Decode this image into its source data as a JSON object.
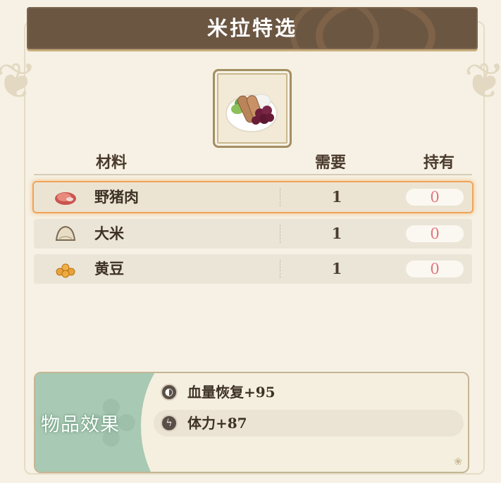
{
  "title": "米拉特选",
  "table": {
    "headers": {
      "material": "材料",
      "need": "需要",
      "own": "持有"
    },
    "rows": [
      {
        "name": "野猪肉",
        "need": "1",
        "own": "0",
        "icon": "boar-meat-icon",
        "selected": true
      },
      {
        "name": "大米",
        "need": "1",
        "own": "0",
        "icon": "rice-sack-icon",
        "selected": false
      },
      {
        "name": "黄豆",
        "need": "1",
        "own": "0",
        "icon": "soybean-icon",
        "selected": false
      }
    ]
  },
  "effects": {
    "label": "物品效果",
    "items": [
      {
        "text": "血量恢复+95",
        "icon": "health-restore-icon"
      },
      {
        "text": "体力+87",
        "icon": "stamina-bolt-icon"
      }
    ]
  },
  "colors": {
    "banner": "#6b5642",
    "highlight": "#f0a457",
    "own_zero": "#e0767f",
    "effects_green": "#a8c9b3"
  }
}
